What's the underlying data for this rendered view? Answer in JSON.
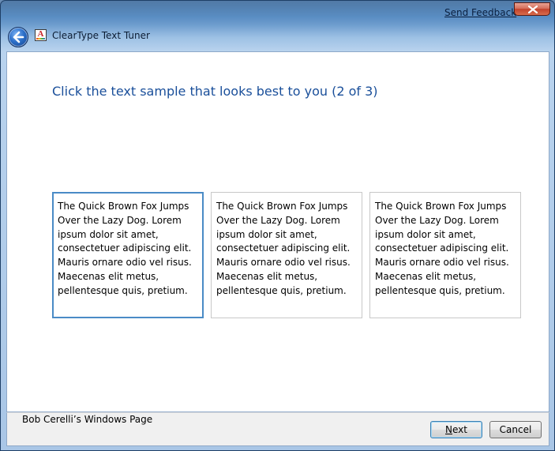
{
  "window": {
    "title": "ClearType Text Tuner",
    "send_feedback": "Send Feedback",
    "icons": {
      "back": "back-arrow-icon",
      "app": "cleartype-icon",
      "close": "close-icon"
    }
  },
  "main": {
    "heading": "Click the text sample that looks best to you (2 of 3)",
    "samples": [
      {
        "lines": [
          "The Quick Brown Fox Jumps",
          "Over the Lazy Dog. Lorem",
          "ipsum dolor sit amet,",
          "consectetuer adipiscing elit.",
          "Mauris ornare odio vel risus.",
          "Maecenas elit metus,",
          "pellentesque quis, pretium."
        ],
        "selected": true
      },
      {
        "lines": [
          "The Quick Brown Fox Jumps",
          "Over the Lazy Dog. Lorem",
          "ipsum dolor sit amet,",
          "consectetuer adipiscing elit.",
          "Mauris ornare odio vel risus.",
          "Maecenas elit metus,",
          "pellentesque quis, pretium."
        ],
        "selected": false
      },
      {
        "lines": [
          "The Quick Brown Fox Jumps",
          "Over the Lazy Dog. Lorem",
          "ipsum dolor sit amet,",
          "consectetuer adipiscing elit.",
          "Mauris ornare odio vel risus.",
          "Maecenas elit metus,",
          "pellentesque quis, pretium."
        ],
        "selected": false
      }
    ]
  },
  "footer": {
    "credit": "Bob Cerelli’s Windows Page",
    "next_prefix": "",
    "next_mnemonic": "N",
    "next_rest": "ext",
    "cancel_label": "Cancel"
  },
  "colors": {
    "heading": "#1a4f9a",
    "selected_border": "#4a8bc6"
  }
}
